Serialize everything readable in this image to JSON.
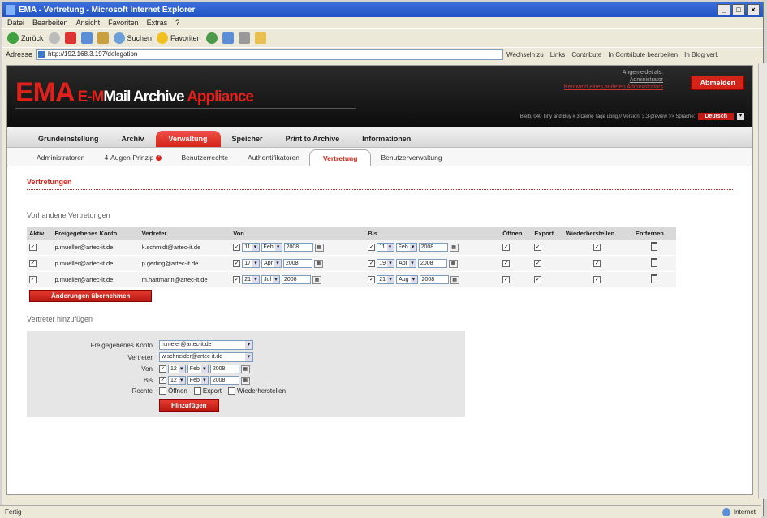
{
  "window": {
    "title": "EMA - Vertretung - Microsoft Internet Explorer"
  },
  "menubar": [
    "Datei",
    "Bearbeiten",
    "Ansicht",
    "Favoriten",
    "Extras",
    "?"
  ],
  "toolbar": {
    "back": "Zurück",
    "search": "Suchen",
    "favorites": "Favoriten"
  },
  "address": {
    "label": "Adresse",
    "url": "http://192.168.3.197/delegation",
    "links": [
      "Wechseln zu",
      "Links",
      "Contribute",
      "In Contribute bearbeiten",
      "In Blog verl."
    ]
  },
  "header": {
    "logo_ema": "EMA",
    "logo_rest_1": "E-",
    "logo_mail": "Mail Archive ",
    "logo_app": "Appliance",
    "user_label": "Angemeldet als:",
    "user_name": "Administrator",
    "user_link": "Kennwort eines anderen Administrators",
    "logout": "Abmelden",
    "status_text": "Bleib, 040 Tiny and Buy # 3 Demo Tage übrig // Version: 3.3-preview >> Sprache:",
    "language": "Deutsch"
  },
  "nav": {
    "items": [
      "Grundeinstellung",
      "Archiv",
      "Verwaltung",
      "Speicher",
      "Print to Archive",
      "Informationen"
    ],
    "active": "Verwaltung"
  },
  "subnav": {
    "items": [
      "Administratoren",
      "4-Augen-Prinzip",
      "Benutzerrechte",
      "Authentifikatoren",
      "Vertretung",
      "Benutzerverwaltung"
    ],
    "active": "Vertretung"
  },
  "content": {
    "title": "Vertretungen",
    "existing_title": "Vorhandene Vertretungen",
    "columns": [
      "Aktiv",
      "Freigegebenes Konto",
      "Vertreter",
      "Von",
      "Bis",
      "Öffnen",
      "Export",
      "Wiederherstellen",
      "Entfernen"
    ],
    "rows": [
      {
        "account": "p.mueller@artec-it.de",
        "deputy": "k.schmidt@artec-it.de",
        "von": [
          "11",
          "Feb",
          "2008"
        ],
        "bis": [
          "11",
          "Feb",
          "2008"
        ]
      },
      {
        "account": "p.mueller@artec-it.de",
        "deputy": "p.gerling@artec-it.de",
        "von": [
          "17",
          "Apr",
          "2008"
        ],
        "bis": [
          "19",
          "Apr",
          "2008"
        ]
      },
      {
        "account": "p.mueller@artec-it.de",
        "deputy": "m.hartmann@artec-it.de",
        "von": [
          "21",
          "Jul",
          "2008"
        ],
        "bis": [
          "21",
          "Aug",
          "2008"
        ]
      }
    ],
    "apply_button": "Änderungen übernehmen",
    "add_title": "Vertreter hinzufügen",
    "add_form": {
      "account_label": "Freigegebenes Konto",
      "account_value": "h.meier@artec-it.de",
      "deputy_label": "Vertreter",
      "deputy_value": "w.schneider@artec-it.de",
      "von_label": "Von",
      "von": [
        "12",
        "Feb",
        "2008"
      ],
      "bis_label": "Bis",
      "bis": [
        "12",
        "Feb",
        "2008"
      ],
      "rights_label": "Rechte",
      "rights": [
        "Öffnen",
        "Export",
        "Wiederherstellen"
      ],
      "add_button": "Hinzufügen"
    }
  },
  "statusbar": {
    "left": "Fertig",
    "zone": "Internet"
  }
}
